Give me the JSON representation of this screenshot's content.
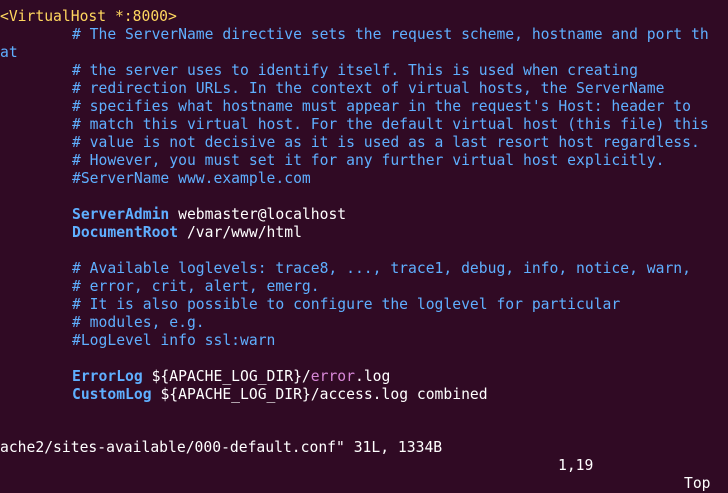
{
  "editor": {
    "vhost_open": "<VirtualHost *:8000>",
    "comment_lines": [
      "# The ServerName directive sets the request scheme, hostname and port th",
      "at",
      "# the server uses to identify itself. This is used when creating",
      "# redirection URLs. In the context of virtual hosts, the ServerName",
      "# specifies what hostname must appear in the request's Host: header to",
      "# match this virtual host. For the default virtual host (this file) this",
      "# value is not decisive as it is used as a last resort host regardless.",
      "# However, you must set it for any further virtual host explicitly.",
      "#ServerName www.example.com"
    ],
    "server_admin_key": "ServerAdmin",
    "server_admin_value": "webmaster@localhost",
    "document_root_key": "DocumentRoot",
    "document_root_value": "/var/www/html",
    "loglevel_comments": [
      "# Available loglevels: trace8, ..., trace1, debug, info, notice, warn,",
      "# error, crit, alert, emerg.",
      "# It is also possible to configure the loglevel for particular",
      "# modules, e.g.",
      "#LogLevel info ssl:warn"
    ],
    "error_log_key": "ErrorLog",
    "error_log_dir": "${APACHE_LOG_DIR}/",
    "error_log_word": "error",
    "error_log_ext": ".log",
    "custom_log_key": "CustomLog",
    "custom_log_value": "${APACHE_LOG_DIR}/access.log combined"
  },
  "status": {
    "file": "ache2/sites-available/000-default.conf\" 31L, 1334B",
    "position": "1,19",
    "scroll": "Top"
  },
  "colors": {
    "background": "#300a24",
    "tag": "#ffd75f",
    "comment": "#5fafff",
    "highlight": "#d787d7"
  }
}
